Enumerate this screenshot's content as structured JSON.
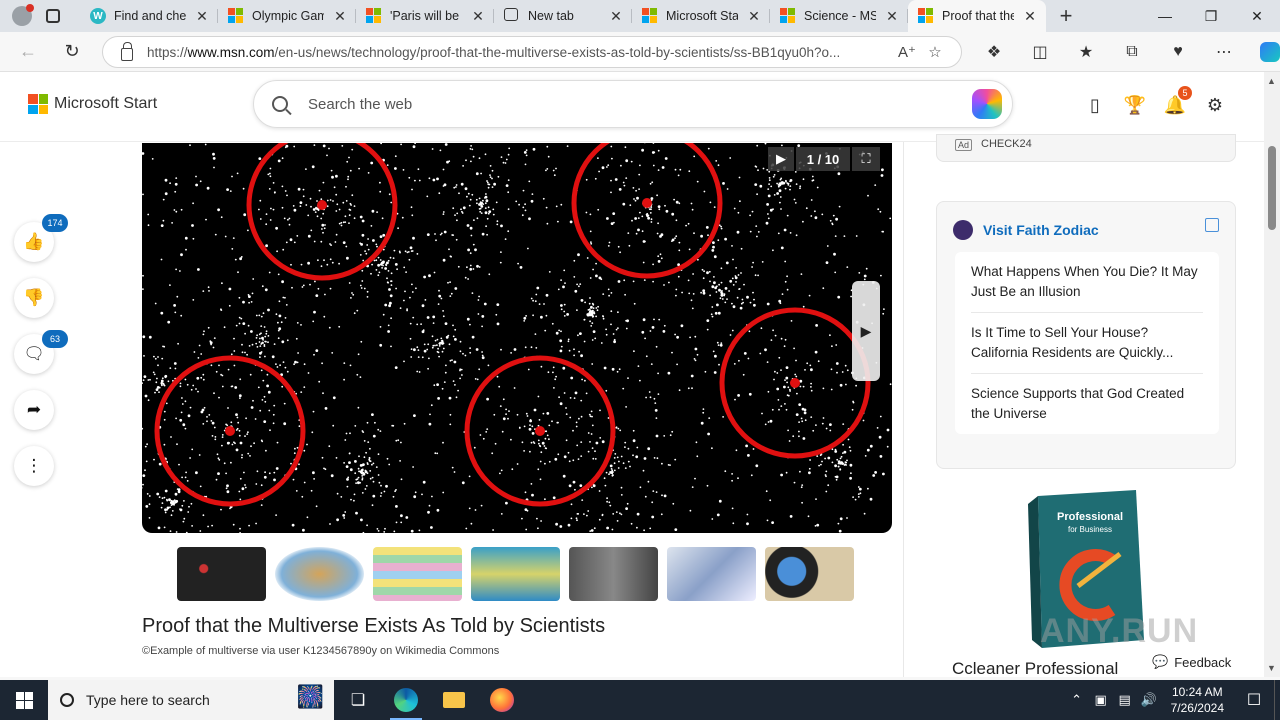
{
  "browser": {
    "tabs": [
      {
        "title": "Find and chec",
        "icon": "w-icon"
      },
      {
        "title": "Olympic Gam",
        "icon": "microsoft-icon"
      },
      {
        "title": "'Paris will be w",
        "icon": "microsoft-icon"
      },
      {
        "title": "New tab",
        "icon": "new-tab-icon"
      },
      {
        "title": "Microsoft Star",
        "icon": "microsoft-icon"
      },
      {
        "title": "Science - MSN",
        "icon": "microsoft-icon"
      },
      {
        "title": "Proof that the",
        "icon": "microsoft-icon",
        "active": true
      }
    ],
    "url_prefix": "https://",
    "url_host": "www.msn.com",
    "url_path": "/en-us/news/technology/proof-that-the-multiverse-exists-as-told-by-scientists/ss-BB1qyu0h?o..."
  },
  "header": {
    "brand": "Microsoft Start",
    "search_placeholder": "Search the web",
    "notification_count": "5"
  },
  "rail": {
    "likes": "174",
    "comments": "63"
  },
  "slideshow": {
    "counter": "1 / 10",
    "title": "Proof that the Multiverse Exists As Told by Scientists",
    "caption": "©Example of multiverse via user K1234567890y on Wikimedia Commons"
  },
  "right_rail": {
    "ad_label": "Ad",
    "ad_name": "CHECK24",
    "card_title": "Visit Faith Zodiac",
    "items": [
      "What Happens When You Die? It May Just Be an Illusion",
      "Is It Time to Sell Your House? California Residents are Quickly...",
      "Science Supports that God Created the Universe"
    ],
    "promo_title": "Ccleaner Professional",
    "promo_box_line1": "Professional",
    "promo_box_line2": "for Business",
    "feedback": "Feedback",
    "watermark": "ANY.RUN"
  },
  "taskbar": {
    "search_placeholder": "Type here to search",
    "time": "10:24 AM",
    "date": "7/26/2024"
  },
  "colors": {
    "accent": "#0f6cbd",
    "notification": "#e8531b",
    "circle": "#e01010"
  }
}
